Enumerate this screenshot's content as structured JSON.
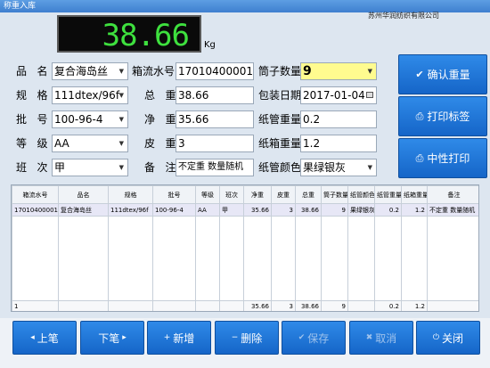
{
  "window": {
    "title": "称重入库",
    "company": "苏州华润纺织有限公司"
  },
  "scale": {
    "value": "38.66",
    "unit": "Kg"
  },
  "form": {
    "product_name": {
      "label": "品   名",
      "value": "复合海岛丝"
    },
    "spec": {
      "label": "规   格",
      "value": "111dtex/96f"
    },
    "batch": {
      "label": "批   号",
      "value": "100-96-4"
    },
    "grade": {
      "label": "等   级",
      "value": "AA"
    },
    "shift": {
      "label": "班   次",
      "value": "甲"
    },
    "box_no": {
      "label": "箱流水号",
      "value": "17010400001"
    },
    "gross": {
      "label": "总   重",
      "value": "38.66"
    },
    "net": {
      "label": "净   重",
      "value": "35.66"
    },
    "tare": {
      "label": "皮   重",
      "value": "3"
    },
    "remark": {
      "label": "备   注",
      "value": "不定重 数量随机"
    },
    "tube_count": {
      "label": "筒子数量",
      "value": "9"
    },
    "pack_date": {
      "label": "包装日期",
      "value": "2017-01-04"
    },
    "tube_weight": {
      "label": "纸管重量",
      "value": "0.2"
    },
    "box_weight": {
      "label": "纸箱重量",
      "value": "1.2"
    },
    "tube_color": {
      "label": "纸管颜色",
      "value": "果绿银灰"
    }
  },
  "side_buttons": {
    "confirm": "确认重量",
    "print_label": "打印标签",
    "neutral_print": "中性打印"
  },
  "table": {
    "headers": [
      "箱流水号",
      "品名",
      "规格",
      "批号",
      "等级",
      "班次",
      "净重",
      "皮重",
      "总重",
      "筒子数量",
      "纸管颜色",
      "纸管重量",
      "纸箱重量",
      "备注"
    ],
    "rows": [
      [
        "17010400001",
        "复合海岛丝",
        "111dtex/96f",
        "100-96-4",
        "AA",
        "甲",
        "35.66",
        "3",
        "38.66",
        "9",
        "果绿银灰",
        "0.2",
        "1.2",
        "不定重 数量随机"
      ]
    ],
    "footer": [
      "1",
      "",
      "",
      "",
      "",
      "",
      "35.66",
      "3",
      "38.66",
      "9",
      "",
      "0.2",
      "1.2",
      ""
    ]
  },
  "bottom_buttons": {
    "prev": "上笔",
    "next": "下笔",
    "add": "新增",
    "delete": "删除",
    "save": "保存",
    "cancel": "取消",
    "close": "关闭"
  },
  "colors": {
    "button": "#1e74d8",
    "display_bg": "#0a0a0a",
    "display_digits": "#3ee03e",
    "highlight_field": "#fffb8f"
  }
}
